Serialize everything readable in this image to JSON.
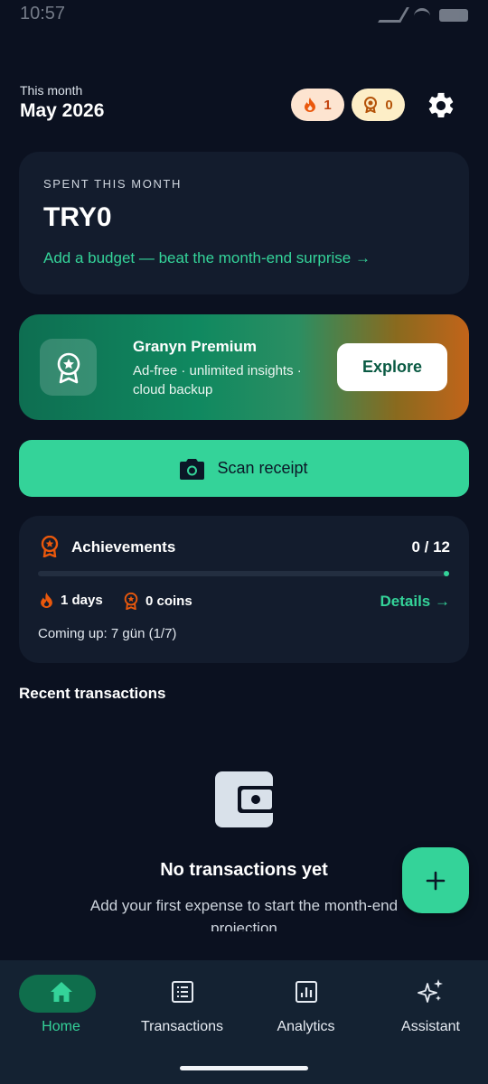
{
  "status_bar": {
    "time": "10:57"
  },
  "header": {
    "subtitle": "This month",
    "month": "May 2026",
    "streak_count": "1",
    "coin_count": "0"
  },
  "spent_card": {
    "label": "SPENT THIS MONTH",
    "amount": "TRY0",
    "budget_link": "Add a budget — beat the month-end surprise →"
  },
  "premium": {
    "title": "Granyn Premium",
    "description": "Ad-free · unlimited insights · cloud backup",
    "button_label": "Explore"
  },
  "scan": {
    "label": "Scan receipt"
  },
  "achievements": {
    "title": "Achievements",
    "count": "0 / 12",
    "progress": 0,
    "streak_label": "1 days",
    "coins_label": "0 coins",
    "details_link": "Details →",
    "coming_up": "Coming up: 7 gün (1/7)"
  },
  "recent": {
    "title": "Recent transactions",
    "empty_title": "No transactions yet",
    "empty_subtitle": "Add your first expense to start the month-end projection"
  },
  "fab": {
    "icon": "plus-icon"
  },
  "nav": {
    "items": [
      {
        "label": "Home",
        "icon": "home-icon",
        "active": true
      },
      {
        "label": "Transactions",
        "icon": "list-icon",
        "active": false
      },
      {
        "label": "Analytics",
        "icon": "chart-icon",
        "active": false
      },
      {
        "label": "Assistant",
        "icon": "sparkle-icon",
        "active": false
      }
    ]
  },
  "colors": {
    "background": "#0b1120",
    "card": "#131c2d",
    "accent": "#34d399",
    "streak": "#ea580c",
    "coin": "#c2410c"
  }
}
